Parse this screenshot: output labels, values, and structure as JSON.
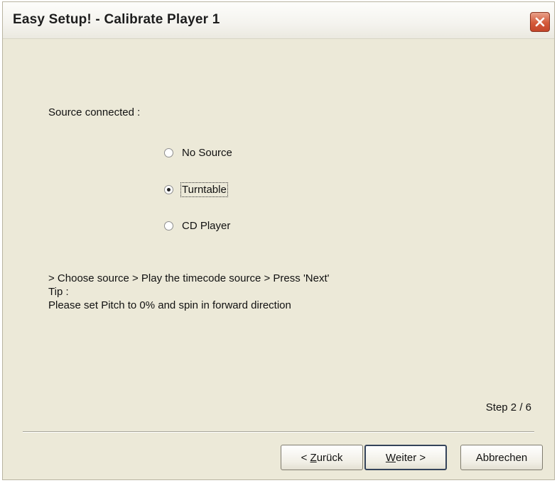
{
  "window": {
    "title": "Easy Setup! - Calibrate Player 1"
  },
  "close_icon": "close-icon",
  "source": {
    "label": "Source connected :",
    "options": [
      {
        "label": "No Source",
        "checked": false
      },
      {
        "label": "Turntable",
        "checked": true
      },
      {
        "label": "CD Player",
        "checked": false
      }
    ]
  },
  "instructions": {
    "line1": "> Choose source > Play the timecode source > Press 'Next'",
    "line2": "Tip :",
    "line3": "Please set Pitch to 0% and spin in forward direction"
  },
  "step": "Step 2 / 6",
  "buttons": {
    "back_prefix": "< ",
    "back_access": "Z",
    "back_rest": "urück",
    "next_access": "W",
    "next_rest": "eiter >",
    "cancel": "Abbrechen"
  },
  "colors": {
    "dialog_bg": "#ece9d8",
    "close_button": "#d45a3a"
  }
}
